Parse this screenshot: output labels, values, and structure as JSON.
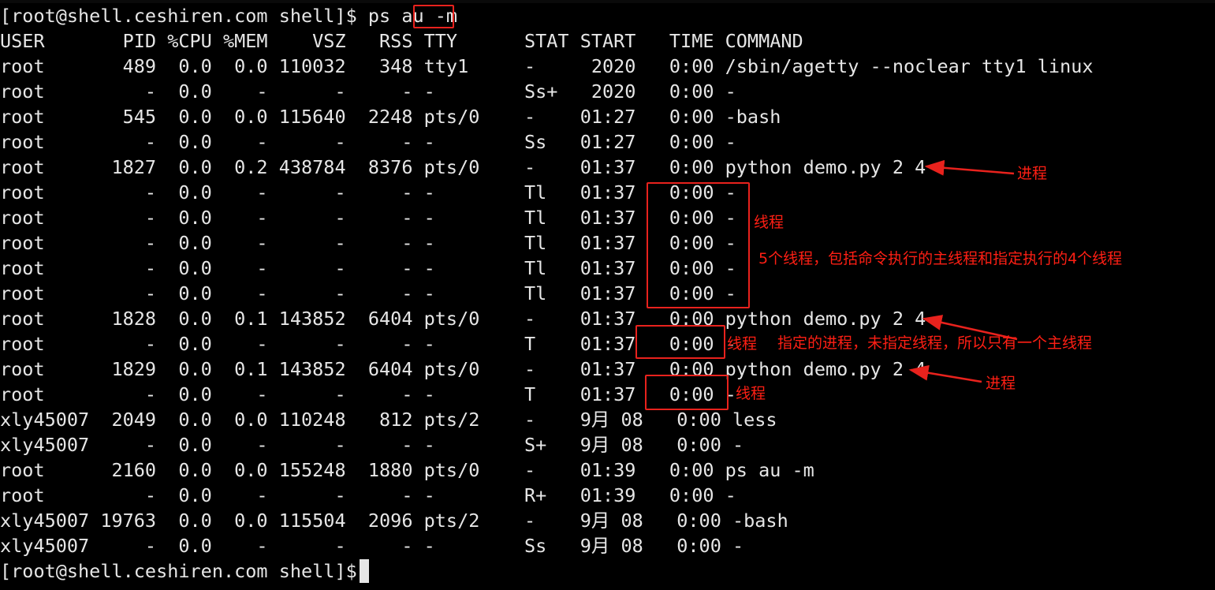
{
  "terminal": {
    "lines": [
      "[root@shell.ceshiren.com shell]$ ps au -m",
      "USER       PID %CPU %MEM    VSZ   RSS TTY      STAT START   TIME COMMAND",
      "root       489  0.0  0.0 110032   348 tty1     -     2020   0:00 /sbin/agetty --noclear tty1 linux",
      "root         -  0.0    -      -     - -        Ss+   2020   0:00 -",
      "root       545  0.0  0.0 115640  2248 pts/0    -    01:27   0:00 -bash",
      "root         -  0.0    -      -     - -        Ss   01:27   0:00 -",
      "root      1827  0.0  0.2 438784  8376 pts/0    -    01:37   0:00 python demo.py 2 4",
      "root         -  0.0    -      -     - -        Tl   01:37   0:00 -",
      "root         -  0.0    -      -     - -        Tl   01:37   0:00 -",
      "root         -  0.0    -      -     - -        Tl   01:37   0:00 -",
      "root         -  0.0    -      -     - -        Tl   01:37   0:00 -",
      "root         -  0.0    -      -     - -        Tl   01:37   0:00 -",
      "root      1828  0.0  0.1 143852  6404 pts/0    -    01:37   0:00 python demo.py 2 4",
      "root         -  0.0    -      -     - -        T    01:37   0:00 -",
      "root      1829  0.0  0.1 143852  6404 pts/0    -    01:37   0:00 python demo.py 2 4",
      "root         -  0.0    -      -     - -        T    01:37   0:00 -",
      "xly45007  2049  0.0  0.0 110248   812 pts/2    -    9月 08   0:00 less",
      "xly45007     -  0.0    -      -     - -        S+   9月 08   0:00 -",
      "root      2160  0.0  0.0 155248  1880 pts/0    -    01:39   0:00 ps au -m",
      "root         -  0.0    -      -     - -        R+   01:39   0:00 -",
      "xly45007 19763  0.0  0.0 115504  2096 pts/2    -    9月 08   0:00 -bash",
      "xly45007     -  0.0    -      -     - -        Ss   9月 08   0:00 -",
      "[root@shell.ceshiren.com shell]$ "
    ]
  },
  "annotations": {
    "process_1": "进程",
    "threads_label": "线程",
    "threads_note": "5个线程，包括命令执行的主线程和指定执行的4个线程",
    "thread_2": "线程",
    "process_2_note": "指定的进程，未指定线程，所以只有一个主线程",
    "process_3": "进程",
    "thread_3": "线程"
  },
  "colors": {
    "background": "#000000",
    "text": "#e6e6e6",
    "annotation": "#ff1f14"
  }
}
